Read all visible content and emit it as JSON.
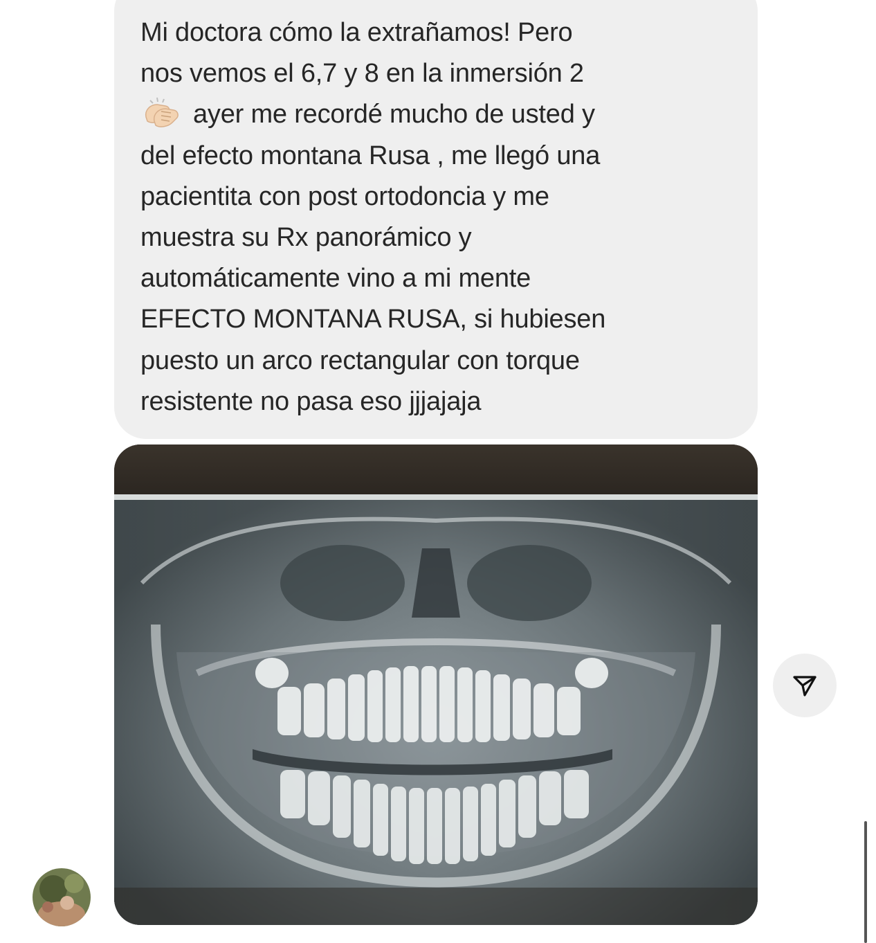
{
  "message": {
    "lines": [
      "Mi doctora cómo la extrañamos! Pero",
      "nos vemos el 6,7 y 8 en la inmersión 2",
      "ayer me recordé mucho de usted y",
      "del efecto montana Rusa , me llegó una",
      "pacientita con post ortodoncia y me",
      "muestra su Rx panorámico y",
      "automáticamente vino a mi mente",
      "EFECTO MONTANA RUSA, si hubiesen",
      "puesto un arco rectangular con torque",
      "resistente no pasa eso jjjajaja"
    ],
    "emoji": "clapping-hands-emoji",
    "bubble_color": "#efefef",
    "text_color": "#262626"
  },
  "attachment": {
    "kind": "photo",
    "subject": "panoramic-dental-xray"
  },
  "actions": {
    "share_icon": "send-icon"
  },
  "sender": {
    "avatar_icon": "user-avatar"
  }
}
